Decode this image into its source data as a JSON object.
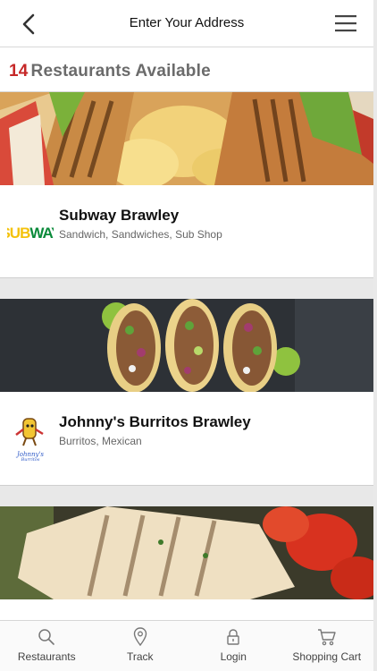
{
  "header": {
    "title": "Enter Your Address",
    "back_icon": "chevron-left-icon",
    "menu_icon": "hamburger-menu-icon"
  },
  "summary": {
    "count": "14",
    "label": "Restaurants Available"
  },
  "restaurants": [
    {
      "name": "Subway Brawley",
      "cuisine": "Sandwich, Sandwiches, Sub Shop",
      "logo_text": "SUBWAY",
      "banner": "sandwich-chips-photo"
    },
    {
      "name": "Johnny's Burritos Brawley",
      "cuisine": "Burritos, Mexican",
      "logo_text": "Johnny's Burritos",
      "banner": "tacos-photo"
    },
    {
      "name": "",
      "cuisine": "",
      "banner": "grilled-fish-tomatoes-photo"
    }
  ],
  "bottom_nav": [
    {
      "label": "Restaurants",
      "icon": "search-icon"
    },
    {
      "label": "Track",
      "icon": "location-pin-icon"
    },
    {
      "label": "Login",
      "icon": "lock-icon"
    },
    {
      "label": "Shopping Cart",
      "icon": "cart-icon"
    }
  ],
  "colors": {
    "count_accent": "#c62828",
    "count_label": "#6b6b6b",
    "subway_yellow": "#f4c20d",
    "subway_green": "#0a8a3a"
  }
}
